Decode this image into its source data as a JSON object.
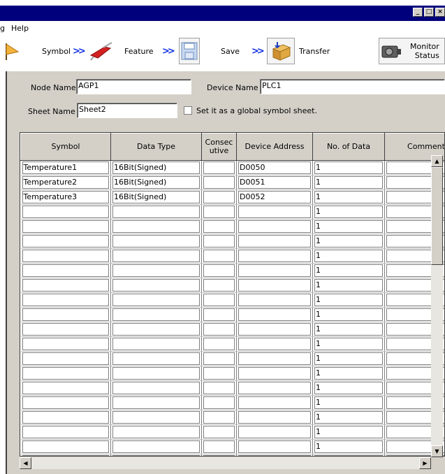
{
  "window": {
    "min_label": "_",
    "max_label": "□",
    "close_label": "×"
  },
  "menu": {
    "items": [
      "g",
      "Help"
    ]
  },
  "toolbar": {
    "symbol": "Symbol",
    "feature": "Feature",
    "save": "Save",
    "transfer": "Transfer",
    "monitor_line1": "Monitor",
    "monitor_line2": "Status",
    "arrow": ">>"
  },
  "form": {
    "node_name_label": "Node Name",
    "node_name_value": "AGP1",
    "device_name_label": "Device Name",
    "device_name_value": "PLC1",
    "sheet_name_label": "Sheet Name",
    "sheet_name_value": "Sheet2",
    "global_label": "Set it as a global symbol sheet."
  },
  "table": {
    "headers": {
      "symbol": "Symbol",
      "data_type": "Data Type",
      "consec1": "Consec",
      "consec2": "utive",
      "device_address": "Device Address",
      "no_of_data": "No. of Data",
      "comment": "Comment"
    },
    "rows": [
      {
        "symbol": "Temperature1",
        "data_type": "16Bit(Signed)",
        "consecutive": "",
        "device_address": "D0050",
        "no_of_data": "1",
        "comment": ""
      },
      {
        "symbol": "Temperature2",
        "data_type": "16Bit(Signed)",
        "consecutive": "",
        "device_address": "D0051",
        "no_of_data": "1",
        "comment": ""
      },
      {
        "symbol": "Temperature3",
        "data_type": "16Bit(Signed)",
        "consecutive": "",
        "device_address": "D0052",
        "no_of_data": "1",
        "comment": ""
      },
      {
        "symbol": "",
        "data_type": "",
        "consecutive": "",
        "device_address": "",
        "no_of_data": "1",
        "comment": ""
      },
      {
        "symbol": "",
        "data_type": "",
        "consecutive": "",
        "device_address": "",
        "no_of_data": "1",
        "comment": ""
      },
      {
        "symbol": "",
        "data_type": "",
        "consecutive": "",
        "device_address": "",
        "no_of_data": "1",
        "comment": ""
      },
      {
        "symbol": "",
        "data_type": "",
        "consecutive": "",
        "device_address": "",
        "no_of_data": "1",
        "comment": ""
      },
      {
        "symbol": "",
        "data_type": "",
        "consecutive": "",
        "device_address": "",
        "no_of_data": "1",
        "comment": ""
      },
      {
        "symbol": "",
        "data_type": "",
        "consecutive": "",
        "device_address": "",
        "no_of_data": "1",
        "comment": ""
      },
      {
        "symbol": "",
        "data_type": "",
        "consecutive": "",
        "device_address": "",
        "no_of_data": "1",
        "comment": ""
      },
      {
        "symbol": "",
        "data_type": "",
        "consecutive": "",
        "device_address": "",
        "no_of_data": "1",
        "comment": ""
      },
      {
        "symbol": "",
        "data_type": "",
        "consecutive": "",
        "device_address": "",
        "no_of_data": "1",
        "comment": ""
      },
      {
        "symbol": "",
        "data_type": "",
        "consecutive": "",
        "device_address": "",
        "no_of_data": "1",
        "comment": ""
      },
      {
        "symbol": "",
        "data_type": "",
        "consecutive": "",
        "device_address": "",
        "no_of_data": "1",
        "comment": ""
      },
      {
        "symbol": "",
        "data_type": "",
        "consecutive": "",
        "device_address": "",
        "no_of_data": "1",
        "comment": ""
      },
      {
        "symbol": "",
        "data_type": "",
        "consecutive": "",
        "device_address": "",
        "no_of_data": "1",
        "comment": ""
      },
      {
        "symbol": "",
        "data_type": "",
        "consecutive": "",
        "device_address": "",
        "no_of_data": "1",
        "comment": ""
      },
      {
        "symbol": "",
        "data_type": "",
        "consecutive": "",
        "device_address": "",
        "no_of_data": "1",
        "comment": ""
      },
      {
        "symbol": "",
        "data_type": "",
        "consecutive": "",
        "device_address": "",
        "no_of_data": "1",
        "comment": ""
      },
      {
        "symbol": "",
        "data_type": "",
        "consecutive": "",
        "device_address": "",
        "no_of_data": "1",
        "comment": ""
      },
      {
        "symbol": "",
        "data_type": "",
        "consecutive": "",
        "device_address": "",
        "no_of_data": "1",
        "comment": ""
      }
    ]
  },
  "colors": {
    "titlebar": "#00007c",
    "face": "#d4d0c8",
    "arrow": "#1030e0"
  },
  "icons": {
    "symbol": "flag-icon",
    "feature": "swiss-knife-icon",
    "save": "floppy-disk-icon",
    "transfer": "transfer-box-icon",
    "monitor": "monitor-camera-icon"
  }
}
